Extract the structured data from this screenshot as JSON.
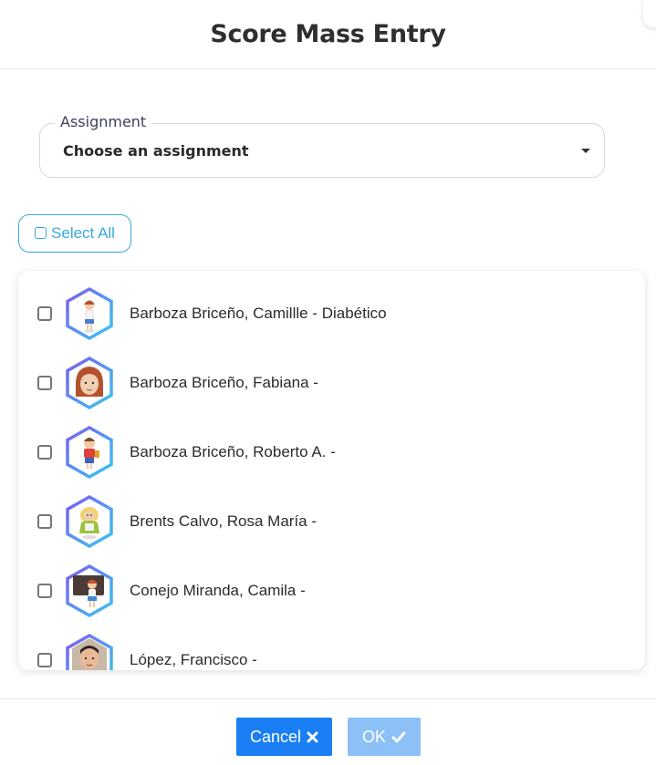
{
  "dialog": {
    "title": "Score Mass Entry"
  },
  "assignment": {
    "label": "Assignment",
    "value": "Choose an assignment"
  },
  "select_all": {
    "label": "Select All"
  },
  "students": [
    {
      "name": "Barboza Briceño, Camillle - Diabético",
      "avatar": "girl-standing-avatar"
    },
    {
      "name": "Barboza Briceño, Fabiana -",
      "avatar": "girl-face-avatar"
    },
    {
      "name": "Barboza Briceño, Roberto A. -",
      "avatar": "boy-with-backpack-avatar"
    },
    {
      "name": "Brents Calvo, Rosa María -",
      "avatar": "girl-blonde-avatar"
    },
    {
      "name": "Conejo Miranda, Camila -",
      "avatar": "girl-at-chalkboard-avatar"
    },
    {
      "name": "López, Francisco -",
      "avatar": "man-face-avatar"
    }
  ],
  "footer": {
    "cancel_label": "Cancel",
    "ok_label": "OK"
  },
  "colors": {
    "primary": "#1a7ff5",
    "primary_disabled": "#8cc0f6",
    "accent": "#3aa8dc"
  }
}
